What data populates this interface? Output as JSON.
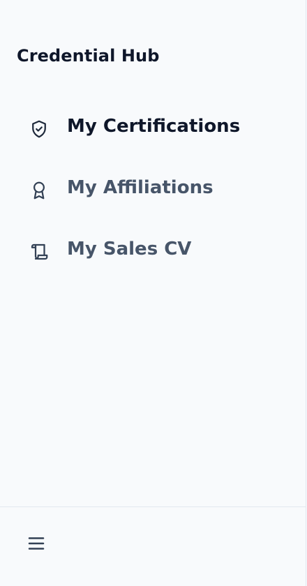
{
  "brand": {
    "title": "Credential Hub"
  },
  "nav": {
    "items": [
      {
        "label": "My Certifications",
        "icon": "shield-check-icon",
        "active": true
      },
      {
        "label": "My Affiliations",
        "icon": "award-ribbon-icon",
        "active": false
      },
      {
        "label": "My Sales CV",
        "icon": "scroll-icon",
        "active": false
      }
    ]
  },
  "footer": {
    "menu_icon": "hamburger-menu-icon"
  },
  "colors": {
    "background": "#f8fafc",
    "text_active": "#0f172a",
    "text_inactive": "#475569",
    "border": "#e2e8f0"
  }
}
